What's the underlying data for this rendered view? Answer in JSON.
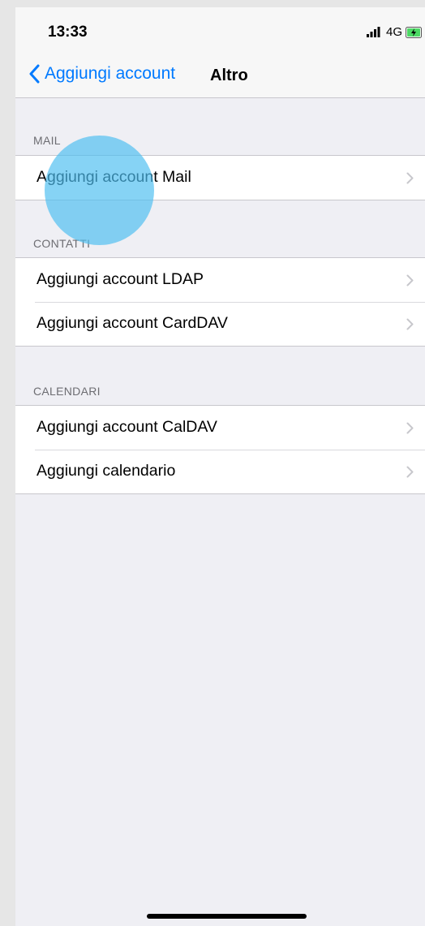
{
  "status_bar": {
    "time": "13:33",
    "network": "4G",
    "signal_icon": "signal-bars-icon",
    "battery_icon": "battery-charging-icon"
  },
  "nav": {
    "back_label": "Aggiungi account",
    "back_icon": "chevron-left-icon",
    "title": "Altro"
  },
  "sections": {
    "mail": {
      "header": "MAIL",
      "items": [
        {
          "label": "Aggiungi account Mail"
        }
      ]
    },
    "contatti": {
      "header": "CONTATTI",
      "items": [
        {
          "label": "Aggiungi account LDAP"
        },
        {
          "label": "Aggiungi account CardDAV"
        }
      ]
    },
    "calendari": {
      "header": "CALENDARI",
      "items": [
        {
          "label": "Aggiungi account CalDAV"
        },
        {
          "label": "Aggiungi calendario"
        }
      ]
    }
  },
  "colors": {
    "accent": "#007aff",
    "background": "#efeff4",
    "touch_indicator": "#4cbef0"
  }
}
